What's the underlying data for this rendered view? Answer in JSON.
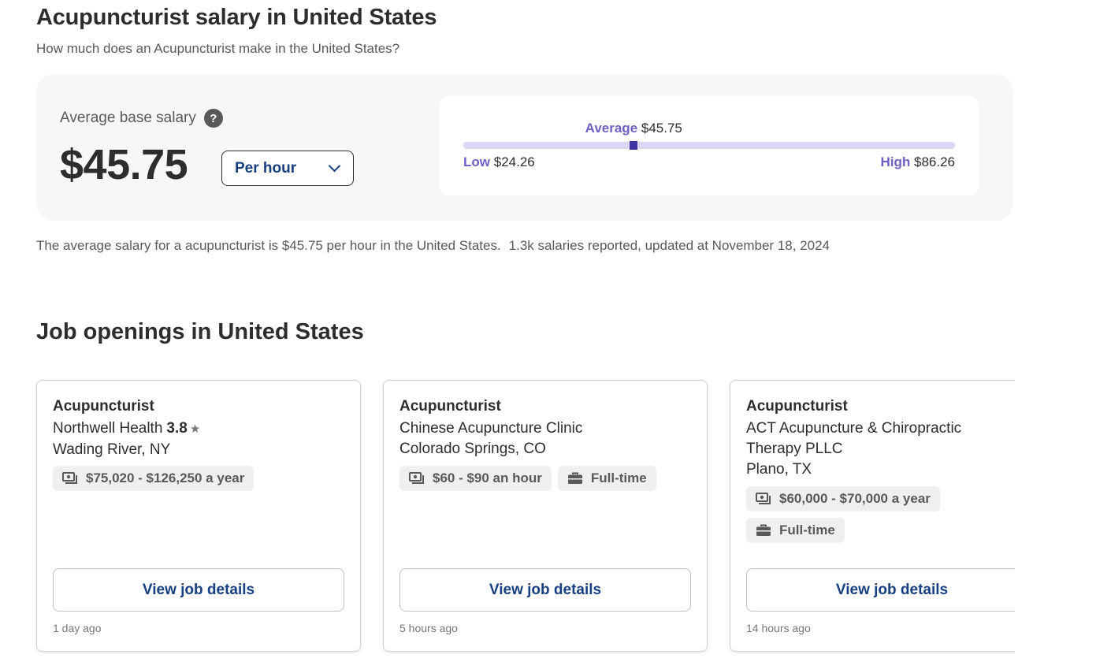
{
  "header": {
    "title": "Acupuncturist salary in United States",
    "subtitle": "How much does an Acupuncturist make in the United States?"
  },
  "salary": {
    "avg_label": "Average base salary",
    "help_icon_glyph": "?",
    "avg_value": "$45.75",
    "period": "Per hour",
    "range": {
      "average_label": "Average",
      "average_value": "$45.75",
      "low_label": "Low",
      "low_value": "$24.26",
      "high_label": "High",
      "high_value": "$86.26",
      "low_num": 24.26,
      "avg_num": 45.75,
      "high_num": 86.26
    },
    "note_main": "The average salary for a acupuncturist is $45.75 per hour in the United States.",
    "note_meta": "1.3k salaries reported, updated at November 18, 2024"
  },
  "jobs_section": {
    "title": "Job openings in United States",
    "button_label": "View job details",
    "jobs": [
      {
        "title": "Acupuncturist",
        "company": "Northwell Health",
        "rating": "3.8",
        "location": "Wading River, NY",
        "pay": "$75,020 - $126,250 a year",
        "job_type": "",
        "posted": "1 day ago"
      },
      {
        "title": "Acupuncturist",
        "company": "Chinese Acupuncture Clinic",
        "rating": "",
        "location": "Colorado Springs, CO",
        "pay": "$60 - $90 an hour",
        "job_type": "Full-time",
        "posted": "5 hours ago"
      },
      {
        "title": "Acupuncturist",
        "company": "ACT Acupuncture & Chiropractic Therapy PLLC",
        "rating": "",
        "location": "Plano, TX",
        "pay": "$60,000 - $70,000 a year",
        "job_type": "Full-time",
        "posted": "14 hours ago"
      }
    ]
  },
  "icons": {
    "star": "star-icon",
    "pay": "money-icon",
    "job_type": "briefcase-icon",
    "dropdown": "chevron-down-icon",
    "help": "question-mark-icon"
  },
  "colors": {
    "brand_blue": "#164081",
    "range_accent": "#6f5fc4",
    "range_track": "#d9d7f6",
    "range_marker": "#3f33a0",
    "panel_bg": "#f8f7f6",
    "tag_bg": "#efefef"
  }
}
